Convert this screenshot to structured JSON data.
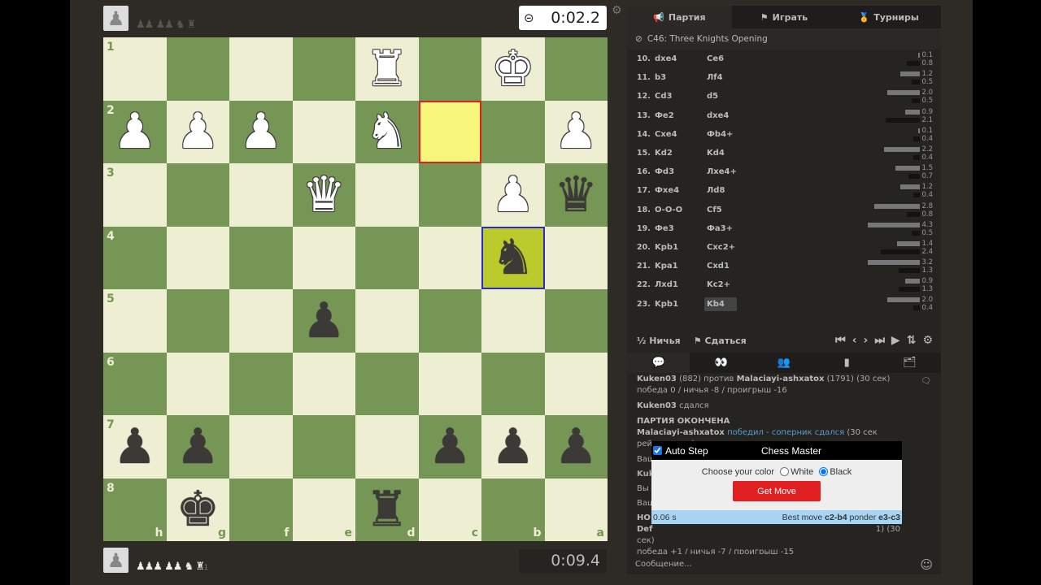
{
  "top_player": {
    "avatar_icon": "pawn-icon",
    "captured": "♟♟ ♟♟ ♞ ♜",
    "clock": "0:02.2",
    "clock_icon": "minus-circle-icon"
  },
  "bottom_player": {
    "avatar_icon": "pawn-icon",
    "captured": "♟♟♟ ♟♟ ♞ ♜",
    "material_diff": "+1",
    "clock": "0:09.4"
  },
  "board": {
    "orientation": "black",
    "colors": {
      "light": "#eeeed2",
      "dark": "#769656",
      "last_move_from": "#f6f67a",
      "last_move_to": "#bbcb2b"
    },
    "rank_labels": [
      "1",
      "2",
      "3",
      "4",
      "5",
      "6",
      "7",
      "8"
    ],
    "file_labels": [
      "h",
      "g",
      "f",
      "e",
      "d",
      "c",
      "b",
      "a"
    ],
    "last_move": {
      "from": "c2",
      "to": "b4"
    },
    "pieces": [
      {
        "sq": "d1",
        "p": "wR"
      },
      {
        "sq": "b1",
        "p": "wK"
      },
      {
        "sq": "h2",
        "p": "wP"
      },
      {
        "sq": "g2",
        "p": "wP"
      },
      {
        "sq": "f2",
        "p": "wP"
      },
      {
        "sq": "d2",
        "p": "wN"
      },
      {
        "sq": "a2",
        "p": "wP"
      },
      {
        "sq": "e3",
        "p": "wQ"
      },
      {
        "sq": "b3",
        "p": "wP"
      },
      {
        "sq": "a3",
        "p": "bQ"
      },
      {
        "sq": "b4",
        "p": "bN"
      },
      {
        "sq": "e5",
        "p": "bP"
      },
      {
        "sq": "h7",
        "p": "bP"
      },
      {
        "sq": "g7",
        "p": "bP"
      },
      {
        "sq": "c7",
        "p": "bP"
      },
      {
        "sq": "b7",
        "p": "bP"
      },
      {
        "sq": "a7",
        "p": "bP"
      },
      {
        "sq": "g8",
        "p": "bK"
      },
      {
        "sq": "d8",
        "p": "bR"
      }
    ]
  },
  "tabs": [
    {
      "label": "Партия",
      "icon": "horn-icon"
    },
    {
      "label": "Играть",
      "icon": "flag-icon"
    },
    {
      "label": "Турниры",
      "icon": "medal-icon"
    }
  ],
  "opening": {
    "icon": "compass-icon",
    "label": "C46: Three Knights Opening"
  },
  "moves": [
    {
      "n": "10.",
      "w": "dxe4",
      "b": "Ce6",
      "ew": 0.1,
      "eb": 0.8
    },
    {
      "n": "11.",
      "w": "b3",
      "b": "Лf4",
      "ew": 1.2,
      "eb": 0.5
    },
    {
      "n": "12.",
      "w": "Cd3",
      "b": "d5",
      "ew": 2.0,
      "eb": 0.5
    },
    {
      "n": "13.",
      "w": "Фe2",
      "b": "dxe4",
      "ew": 0.9,
      "eb": 2.1
    },
    {
      "n": "14.",
      "w": "Cxe4",
      "b": "Фb4+",
      "ew": 0.1,
      "eb": 0.4
    },
    {
      "n": "15.",
      "w": "Kd2",
      "b": "Kd4",
      "ew": 2.2,
      "eb": 0.4
    },
    {
      "n": "16.",
      "w": "Фd3",
      "b": "Лxe4+",
      "ew": 1.5,
      "eb": 0.7
    },
    {
      "n": "17.",
      "w": "Фxe4",
      "b": "Лd8",
      "ew": 1.2,
      "eb": 0.4
    },
    {
      "n": "18.",
      "w": "O-O-O",
      "b": "Cf5",
      "ew": 2.8,
      "eb": 0.8
    },
    {
      "n": "19.",
      "w": "Фe3",
      "b": "Фa3+",
      "ew": 4.3,
      "eb": 0.5
    },
    {
      "n": "20.",
      "w": "Kpb1",
      "b": "Cxc2+",
      "ew": 1.4,
      "eb": 2.4
    },
    {
      "n": "21.",
      "w": "Kpa1",
      "b": "Cxd1",
      "ew": 3.2,
      "eb": 1.3
    },
    {
      "n": "22.",
      "w": "Лxd1",
      "b": "Kc2+",
      "ew": 0.9,
      "eb": 1.3
    },
    {
      "n": "23.",
      "w": "Kpb1",
      "b": "Kb4",
      "ew": 2.0,
      "eb": 0.4
    }
  ],
  "controls": {
    "draw": "Ничья",
    "draw_icon": "½",
    "resign": "Сдаться",
    "resign_icon": "flag-icon",
    "nav": [
      "⏮",
      "‹",
      "›",
      "⏭",
      "▶",
      "⇅",
      "⚙"
    ]
  },
  "chat_tabs": [
    "chat-icon",
    "binoculars-icon",
    "users-icon",
    "podium-icon",
    "folder-icon"
  ],
  "chat": {
    "l1_p1": "Kuken03",
    "l1_r1": " (882) против ",
    "l1_p2": "Malaciayi-ashxatox",
    "l1_r2": " (1791) (30 сек)",
    "l2": "победа 0 / ничья -8 / проигрыш -16",
    "l3_p": "Kuken03",
    "l3_r": " сдался",
    "l4": "ПАРТИЯ ОКОНЧЕНА",
    "l5_p": "Malaciayi-ashxatox",
    "l5_link": " победил - соперник сдался",
    "l5_r": " (30 сек рейтинговая)",
    "h1": "Ваш",
    "h2": "Kuk",
    "h3": "Вы",
    "h4": "Ваш",
    "h5": "НО",
    "h6": "Def",
    "h6_r": "1) (30",
    "l6": "сек)",
    "l7": "победа +1 / ничья -7 / проигрыш -15",
    "placeholder": "Сообщение..."
  },
  "popup": {
    "auto_step": "Auto Step",
    "auto_checked": true,
    "title": "Chess Master",
    "choose": "Choose your color",
    "white": "White",
    "black": "Black",
    "selected": "Black",
    "button": "Get Move",
    "time": "0.06 s",
    "best_label": "Best move ",
    "best": "c2-b4",
    "ponder_label": " ponder ",
    "ponder": "e3-c3",
    "button_color": "#e02020"
  }
}
